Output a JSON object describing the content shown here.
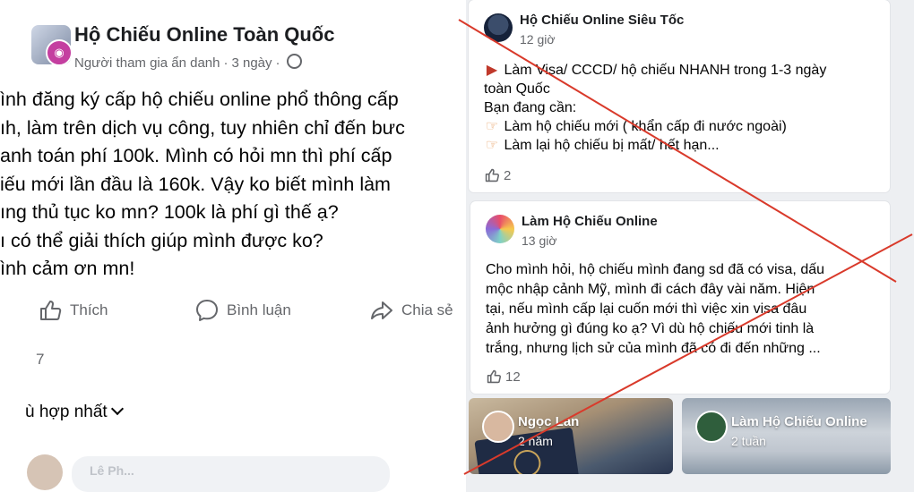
{
  "left_post": {
    "author": "Hộ Chiếu Online Toàn Quốc",
    "meta_author": "Người tham gia ẩn danh",
    "meta_time": "3 ngày",
    "body_lines": [
      "ình đăng ký cấp hộ chiếu online phổ thông cấp",
      "ıh, làm trên dịch vụ công, tuy nhiên chỉ đến bưc",
      "anh toán phí 100k. Mình có hỏi mn thì phí cấp",
      "iếu mới lần đầu là 160k. Vậy ko biết mình làm",
      "ıng thủ tục ko mn? 100k là phí gì thế ạ?",
      "ı có thể giải thích giúp mình được ko?",
      "ình cảm ơn mn!"
    ],
    "actions": {
      "like": "Thích",
      "comment": "Bình luận",
      "share": "Chia sẻ"
    },
    "reaction_count": "7",
    "sort_label": "ù hợp nhất",
    "comment_preview_name": "Lê Ph..."
  },
  "right_posts": [
    {
      "author": "Hộ Chiếu Online Siêu Tốc",
      "time": "12 giờ",
      "body_lines": [
        {
          "icon": "megaphone-icon",
          "text": "Làm Visa/ CCCD/ hộ chiếu NHANH trong 1-3 ngày"
        },
        {
          "icon": "",
          "text": "toàn Quốc"
        },
        {
          "icon": "",
          "text": "Bạn đang cần:"
        },
        {
          "icon": "pointing-hand-icon",
          "text": "Làm hộ chiếu mới ( khẩn cấp đi nước ngoài)"
        },
        {
          "icon": "pointing-hand-icon",
          "text": "Làm lại hộ chiếu bị mất/ hết hạn..."
        }
      ],
      "likes": "2"
    },
    {
      "author": "Làm Hộ Chiếu Online",
      "time": "13 giờ",
      "body_lines": [
        {
          "icon": "",
          "text": "Cho mình hỏi, hộ chiếu mình đang sd đã có visa, dấu"
        },
        {
          "icon": "",
          "text": "mộc nhập cảnh Mỹ, mình đi cách đây vài năm. Hiện"
        },
        {
          "icon": "",
          "text": "tại, nếu mình cấp lại cuốn mới thì việc xin visa đâu"
        },
        {
          "icon": "",
          "text": "ảnh hưởng gì đúng ko ạ? Vì dù hộ chiếu mới tinh là"
        },
        {
          "icon": "",
          "text": "trắng, nhưng lịch sử của mình đã có đi đến những ..."
        }
      ],
      "likes": "12"
    }
  ],
  "tiles": [
    {
      "author": "Ngọc Lan",
      "time": "2 năm"
    },
    {
      "author": "Làm Hộ Chiếu Online",
      "time": "2 tuần"
    }
  ],
  "colors": {
    "cross_red": "#d93a2b",
    "meta_gray": "#65676b",
    "anon_badge": "#c43fa0"
  }
}
